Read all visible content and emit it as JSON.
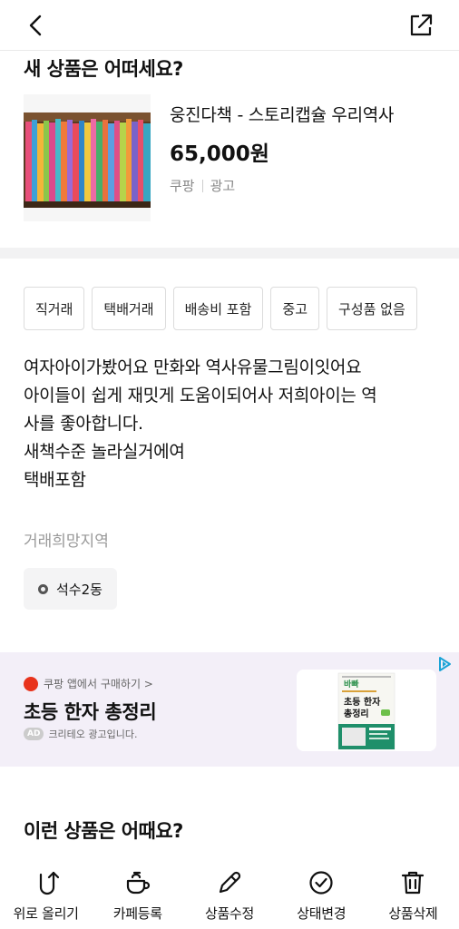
{
  "header": {
    "back_icon": "chevron-left-icon",
    "share_icon": "share-external-icon"
  },
  "recommendation": {
    "title": "새 상품은 어떠세요?",
    "product": {
      "name": "웅진다책 - 스토리캡슐 우리역사",
      "price": "65,000원",
      "seller": "쿠팡",
      "ad_label": "광고"
    }
  },
  "listing": {
    "tags": [
      "직거래",
      "택배거래",
      "배송비 포함",
      "중고",
      "구성품 없음"
    ],
    "description_lines": [
      "여자아이가봤어요  만화와 역사유물그림이잇어요",
      "아이들이 쉽게 재밋게 도움이되어사 저희아이는 역",
      "사를 좋아합니다.",
      "새책수준 놀라실거에여",
      "택배포함"
    ],
    "area_label": "거래희망지역",
    "area_value": "석수2동"
  },
  "ad": {
    "source": "쿠팡 앱에서 구매하기 >",
    "title": "초등 한자 총정리",
    "badge": "AD",
    "note": "크리테오 광고입니다.",
    "book_cover_text": [
      "바빠",
      "초등 한자",
      "총정리"
    ],
    "brand_color": "#e8331c"
  },
  "more": {
    "title": "이런 상품은 어때요?"
  },
  "bottom_bar": {
    "items": [
      {
        "label": "위로 올리기",
        "icon": "bump-up-icon"
      },
      {
        "label": "카페등록",
        "icon": "coffee-cup-icon"
      },
      {
        "label": "상품수정",
        "icon": "pencil-icon"
      },
      {
        "label": "상태변경",
        "icon": "check-circle-icon"
      },
      {
        "label": "상품삭제",
        "icon": "trash-icon"
      }
    ]
  }
}
